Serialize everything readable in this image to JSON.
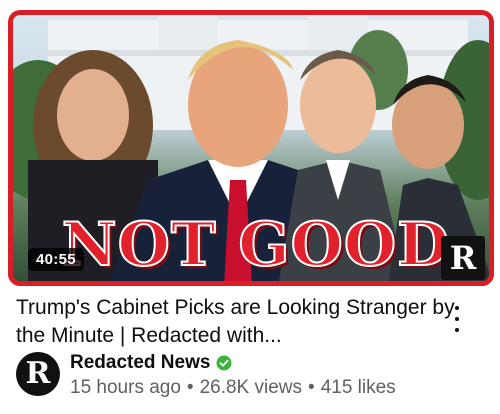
{
  "video": {
    "duration": "40:55",
    "thumbnail_headline": "NOT GOOD",
    "thumbnail_logo_letter": "R",
    "title": "Trump's Cabinet Picks are Looking Stranger by the Minute | Redacted with...",
    "more_icon": "more-vert-icon"
  },
  "channel": {
    "avatar_letter": "R",
    "name": "Redacted News",
    "verified": true,
    "verified_color": "#3db33d",
    "verified_icon": "check-badge-icon"
  },
  "stats": {
    "age": "15 hours ago",
    "separator": "•",
    "views": "26.8K views",
    "likes": "415 likes"
  },
  "colors": {
    "accent_red": "#d81f26",
    "meta_gray": "#606060"
  }
}
